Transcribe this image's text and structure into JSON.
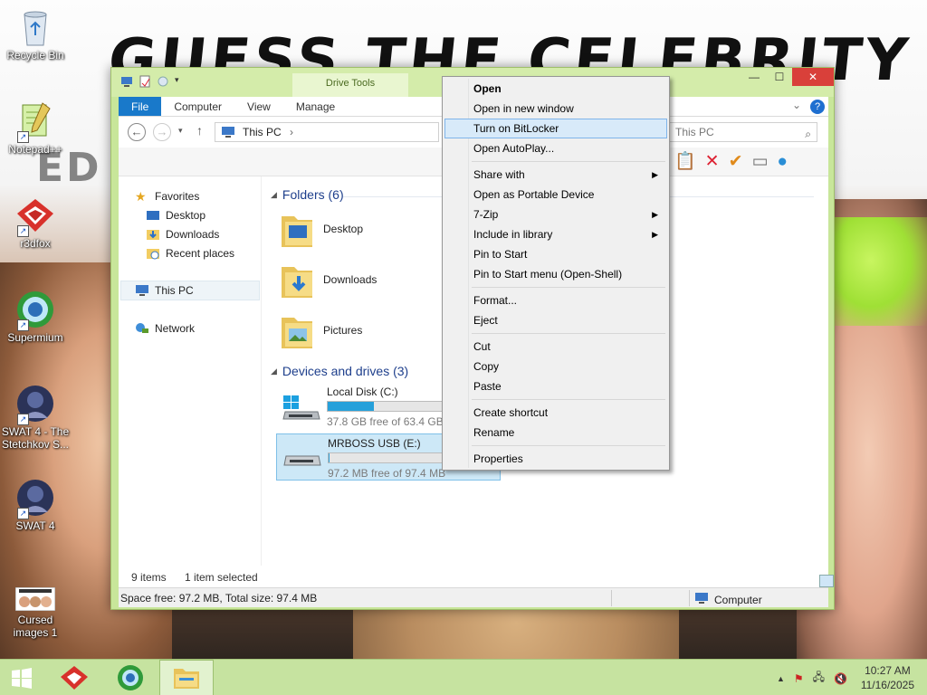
{
  "wallpaper": {
    "title": "GUESS THE CELEBRITY",
    "subtitle": "ED S                                 ON M"
  },
  "desktop_icons": [
    {
      "label": "Recycle Bin",
      "icon": "recycle-bin-icon"
    },
    {
      "label": "Notepad++",
      "icon": "notepad-plus-icon"
    },
    {
      "label": "r3dfox",
      "icon": "r3dfox-icon"
    },
    {
      "label": "Supermium",
      "icon": "supermium-icon"
    },
    {
      "label": "SWAT 4 - The Stetchkov S...",
      "icon": "swat4-expansion-icon"
    },
    {
      "label": "SWAT 4",
      "icon": "swat4-icon"
    },
    {
      "label": "Cursed images 1",
      "icon": "cursed-images-icon"
    }
  ],
  "window": {
    "contextual_tab_group": "Drive Tools",
    "tabs": [
      "File",
      "Computer",
      "View",
      "Manage"
    ],
    "address": "This PC",
    "search_placeholder": "This PC",
    "navigation": {
      "favorites_label": "Favorites",
      "favorites": [
        "Desktop",
        "Downloads",
        "Recent places"
      ],
      "this_pc": "This PC",
      "network": "Network"
    },
    "folders_header": "Folders (6)",
    "folders": [
      "Desktop",
      "Downloads",
      "Pictures"
    ],
    "devices_header": "Devices and drives (3)",
    "drives": [
      {
        "name": "Local Disk (C:)",
        "free_text": "37.8 GB free of 63.4 GB",
        "used_fraction": 0.404,
        "selected": false
      },
      {
        "name": "MRBOSS USB (E:)",
        "free_text": "97.2 MB free of 97.4 MB",
        "used_fraction": 0.002,
        "selected": true
      }
    ],
    "status": {
      "items_count": "9 items",
      "selected": "1 item selected",
      "details": "Space free: 97.2 MB, Total size: 97.4 MB",
      "location": "Computer"
    }
  },
  "context_menu": {
    "items": [
      {
        "label": "Open",
        "bold": true,
        "submenu": false
      },
      {
        "label": "Open in new window",
        "submenu": false
      },
      {
        "label": "Turn on BitLocker",
        "submenu": false,
        "highlighted": true
      },
      {
        "label": "Open AutoPlay...",
        "submenu": false
      },
      {
        "label": "Share with",
        "submenu": true
      },
      {
        "label": "Open as Portable Device",
        "submenu": false
      },
      {
        "label": "7-Zip",
        "submenu": true
      },
      {
        "label": "Include in library",
        "submenu": true
      },
      {
        "label": "Pin to Start",
        "submenu": false
      },
      {
        "label": "Pin to Start menu (Open-Shell)",
        "submenu": false
      },
      {
        "label": "Format...",
        "submenu": false
      },
      {
        "label": "Eject",
        "submenu": false
      },
      {
        "label": "Cut",
        "submenu": false
      },
      {
        "label": "Copy",
        "submenu": false
      },
      {
        "label": "Paste",
        "submenu": false
      },
      {
        "label": "Create shortcut",
        "submenu": false
      },
      {
        "label": "Rename",
        "submenu": false
      },
      {
        "label": "Properties",
        "submenu": false
      }
    ]
  },
  "taskbar": {
    "pinned": [
      "start-button",
      "r3dfox-taskbar-icon",
      "supermium-taskbar-icon",
      "file-explorer-taskbar-icon"
    ],
    "tray_icons": [
      "show-hidden-icons-chevron",
      "action-center-flag-icon",
      "network-icon",
      "volume-muted-icon"
    ],
    "time": "10:27 AM",
    "date": "11/16/2025"
  },
  "colors": {
    "accent": "#1979ca",
    "window_frame": "#c8e69a",
    "taskbar": "#c6e3a0",
    "selection": "#cde8f7",
    "close_button": "#d9403a"
  }
}
